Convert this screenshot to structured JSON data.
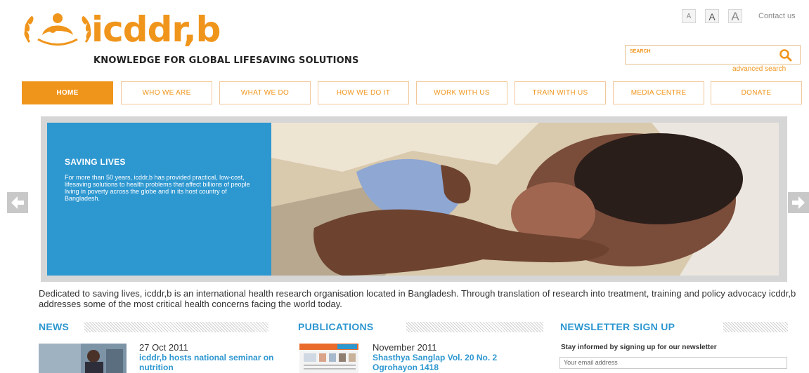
{
  "header": {
    "logo_text": "icddr,b",
    "tagline": "KNOWLEDGE FOR GLOBAL LIFESAVING SOLUTIONS",
    "font_size_small": "A",
    "font_size_medium": "A",
    "font_size_large": "A",
    "contact": "Contact us",
    "search_placeholder": "SEARCH",
    "advanced_search": "advanced search"
  },
  "nav": {
    "items": [
      {
        "label": "HOME",
        "active": true
      },
      {
        "label": "WHO WE ARE"
      },
      {
        "label": "WHAT WE DO"
      },
      {
        "label": "HOW WE DO IT"
      },
      {
        "label": "WORK WITH US"
      },
      {
        "label": "TRAIN WITH US"
      },
      {
        "label": "MEDIA CENTRE"
      },
      {
        "label": "DONATE"
      }
    ]
  },
  "slider": {
    "title": "SAVING LIVES",
    "body": "For more than 50 years, icddr,b has provided practical, low-cost, lifesaving solutions to health problems that affect billions of people living in poverty across the globe and in its host country of Bangladesh.",
    "prev_icon": "arrow-left-icon",
    "next_icon": "arrow-right-icon"
  },
  "intro": "Dedicated to saving lives, icddr,b is an international health research organisation located in Bangladesh. Through translation of research into treatment, training and policy advocacy icddr,b addresses some of the most critical health concerns facing the world today.",
  "news": {
    "title": "NEWS",
    "date": "27 Oct 2011",
    "headline": "icddr,b hosts national seminar on nutrition"
  },
  "publications": {
    "title": "PUBLICATIONS",
    "date": "November 2011",
    "headline": "Shasthya Sanglap Vol. 20 No. 2 Ogrohayon 1418"
  },
  "newsletter": {
    "title": "NEWSLETTER SIGN UP",
    "text": "Stay informed by signing up for our newsletter",
    "email_placeholder": "Your email address"
  },
  "colors": {
    "brand_orange": "#f0951c",
    "brand_blue": "#2d97d0"
  }
}
